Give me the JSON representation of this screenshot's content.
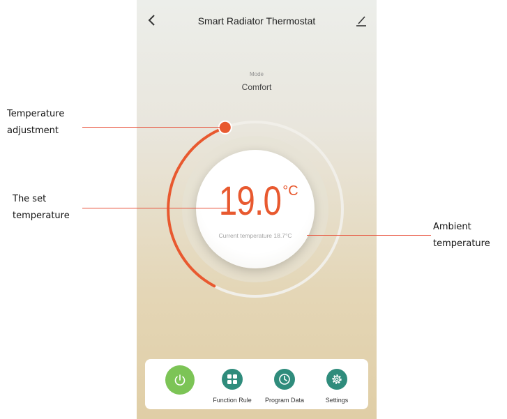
{
  "header": {
    "title": "Smart Radiator Thermostat"
  },
  "mode": {
    "label": "Mode",
    "value": "Comfort"
  },
  "thermostat": {
    "set_value": "19.0",
    "unit": "°C",
    "current": "Current temperature 18.7°C"
  },
  "toolbar": [
    {
      "label": ""
    },
    {
      "label": "Function Rule"
    },
    {
      "label": "Program Data"
    },
    {
      "label": "Settings"
    }
  ],
  "annotations": {
    "adjust_line1": "Temperature",
    "adjust_line2": "adjustment",
    "set_line1": "The set",
    "set_line2": "temperature",
    "ambient_line1": "Ambient",
    "ambient_line2": "temperature"
  },
  "colors": {
    "accent": "#e8592f",
    "power": "#7cc456",
    "teal": "#2f8c7c",
    "annotation_line": "#e8503a"
  }
}
